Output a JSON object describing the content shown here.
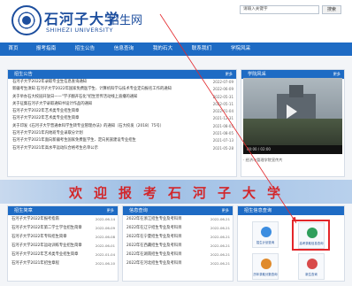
{
  "header": {
    "school_cn": "石河子大学",
    "school_en": "SHIHEZI UNIVERSITY",
    "site_name": "招生网",
    "search_placeholder": "请输入关键字",
    "search_button": "搜索"
  },
  "nav": [
    "首页",
    "报考指南",
    "招生公告",
    "信息查询",
    "我的石大",
    "联系我们",
    "学院风采"
  ],
  "notices": {
    "title": "招生公告",
    "more": "更多",
    "items": [
      {
        "text": "石河子大学2022年录取专业生信息查询通知",
        "date": "2022-07-09"
      },
      {
        "text": "新疆考生须知 石河子大学2022年国家免费医学生、计算机科学与技术专业定向报名工作的通知",
        "date": "2022-06-09"
      },
      {
        "text": "关于举办石大校园开放日——\"学子翻开石化\"招生宣传活动线上直播的通知",
        "date": "2022-05-31"
      },
      {
        "text": "关于征集石河子大学录取通知书设计作品的通知",
        "date": "2022-05-11"
      },
      {
        "text": "石河子大学2022年艺术类专业招生简章",
        "date": "2022-01-04"
      },
      {
        "text": "石河子大学2022年艺术类专业招生简章",
        "date": "2021-12-31"
      },
      {
        "text": "关于印发《石河子大学普通本科学生转专业管理办法》的通知（石大校发〔2018〕75号）",
        "date": "2021-08-05"
      },
      {
        "text": "石河子大学2021年内地班专业录取分计划",
        "date": "2021-08-05"
      },
      {
        "text": "石河子大学2021年面向新疆考生国家免费医学生、定向民族建设专业招生",
        "date": "2021-07-13"
      },
      {
        "text": "石河子大学2021年高水平运动队合格考生名单公示",
        "date": "2021-05-28"
      }
    ]
  },
  "campus": {
    "title": "学院风采",
    "more": "更多",
    "video_time": "00:00 / 02:00",
    "caption": "· 经济与管理学院宣传片"
  },
  "banner_text": "欢迎报考石河子大学",
  "brief": {
    "title": "招生简章",
    "more": "更多",
    "items": [
      {
        "text": "石河子大学2022年报考指南",
        "date": "2022-06-14"
      },
      {
        "text": "石河子大学2022年第二学士学位招生简章",
        "date": "2022-06-09"
      },
      {
        "text": "石河子大学2022年专科招生简章",
        "date": "2022-06-08"
      },
      {
        "text": "石河子大学2022年运动训练专业招生简章",
        "date": "2022-06-01"
      },
      {
        "text": "石河子大学2022年艺术类专业招生简章",
        "date": "2022-01-04"
      },
      {
        "text": "石河子大学2021年招生章程",
        "date": "2021-06-10"
      }
    ]
  },
  "inquiry": {
    "title": "信息查询",
    "more": "更多",
    "items": [
      {
        "text": "2022年在浙江招生专业及考科目",
        "date": "2022-06-21"
      },
      {
        "text": "2022年在辽宁招生专业及考科目",
        "date": "2022-06-21"
      },
      {
        "text": "2022年在宁夏招生专业及考科目",
        "date": "2022-06-21"
      },
      {
        "text": "2022年在西藏招生专业及考科目",
        "date": "2022-06-21"
      },
      {
        "text": "2022年在湖南招生专业及考科目",
        "date": "2022-06-21"
      },
      {
        "text": "2022年在河北招生专业及考科目",
        "date": "2022-06-21"
      }
    ]
  },
  "service": {
    "title": "招生信息查询",
    "tiles": [
      {
        "label": "招生计划查询",
        "color": "#3b8de0"
      },
      {
        "label": "高考录取信息查询",
        "color": "#2f9e5c"
      },
      {
        "label": "历年录取分数查询",
        "color": "#e08a2b"
      },
      {
        "label": "新生查询",
        "color": "#d84a4a"
      }
    ]
  },
  "colors": {
    "primary": "#1e6bc4",
    "accent": "#d2262a"
  }
}
